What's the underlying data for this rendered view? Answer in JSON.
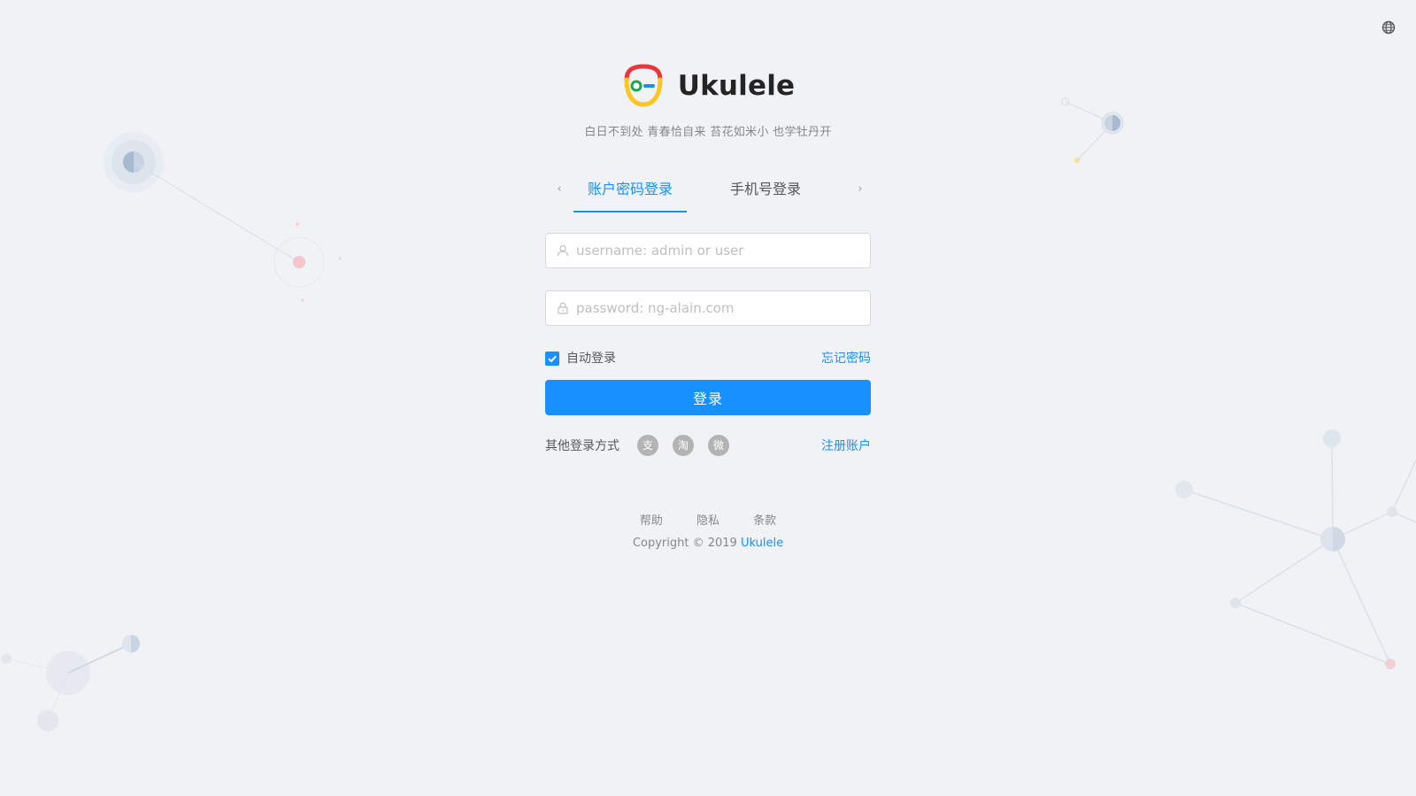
{
  "header": {
    "app_title": "Ukulele",
    "tagline": "白日不到处 青春恰自来 苔花如米小 也学牡丹开"
  },
  "tabs": [
    {
      "label": "账户密码登录",
      "active": true
    },
    {
      "label": "手机号登录",
      "active": false
    }
  ],
  "form": {
    "username_placeholder": "username: admin or user",
    "username_value": "",
    "password_placeholder": "password: ng-alain.com",
    "password_value": "",
    "remember_label": "自动登录",
    "remember_checked": true,
    "forgot_label": "忘记密码",
    "submit_label": "登录"
  },
  "other_login": {
    "label": "其他登录方式",
    "icons": [
      {
        "name": "alipay-icon",
        "glyph": "支"
      },
      {
        "name": "taobao-icon",
        "glyph": "淘"
      },
      {
        "name": "weibo-icon",
        "glyph": "微"
      }
    ],
    "register_label": "注册账户"
  },
  "footer": {
    "links": [
      "帮助",
      "隐私",
      "条款"
    ],
    "copyright_prefix": "Copyright",
    "copyright_symbol": "©",
    "copyright_year": "2019",
    "copyright_brand": "Ukulele"
  },
  "colors": {
    "primary": "#1890ff",
    "background": "#f0f2f5"
  },
  "icons": {
    "language": "globe-icon",
    "user_prefix": "user-icon",
    "lock_prefix": "lock-icon",
    "tab_prev": "chevron-left-icon",
    "tab_next": "chevron-right-icon"
  }
}
